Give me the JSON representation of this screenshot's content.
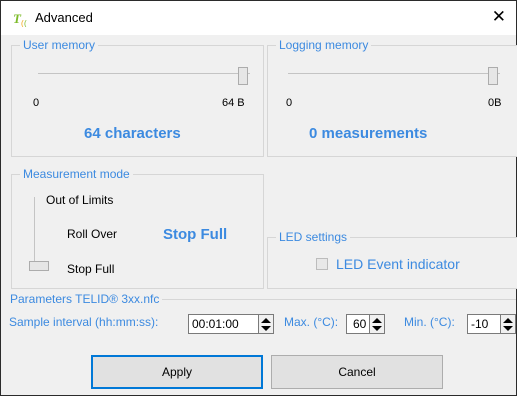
{
  "window": {
    "title": "Advanced",
    "close_glyph": "✕"
  },
  "user_memory": {
    "legend": "User memory",
    "min_label": "0",
    "max_label": "64 B",
    "slider_value_fraction": 1.0,
    "summary": "64 characters"
  },
  "logging_memory": {
    "legend": "Logging memory",
    "min_label": "0",
    "max_label": "0B",
    "slider_value_fraction": 1.0,
    "summary": "0 measurements"
  },
  "measurement_mode": {
    "legend": "Measurement mode",
    "options": [
      "Out of Limits",
      "Roll Over",
      "Stop Full"
    ],
    "selected": "Stop Full"
  },
  "led_settings": {
    "legend": "LED settings",
    "checkbox_label": "LED Event indicator",
    "checked": false
  },
  "parameters": {
    "legend": "Parameters TELID® 3xx.nfc",
    "sample_interval_label": "Sample interval (hh:mm:ss):",
    "sample_interval_value": "00:01:00",
    "max_label": "Max. (°C):",
    "max_value": "60",
    "min_label": "Min. (°C):",
    "min_value": "-10"
  },
  "buttons": {
    "apply": "Apply",
    "cancel": "Cancel"
  },
  "colors": {
    "accent": "#3c8ae0",
    "logo_green": "#7dbb2a"
  },
  "icons": {
    "app": "telid-logo-icon",
    "close": "close-icon"
  }
}
